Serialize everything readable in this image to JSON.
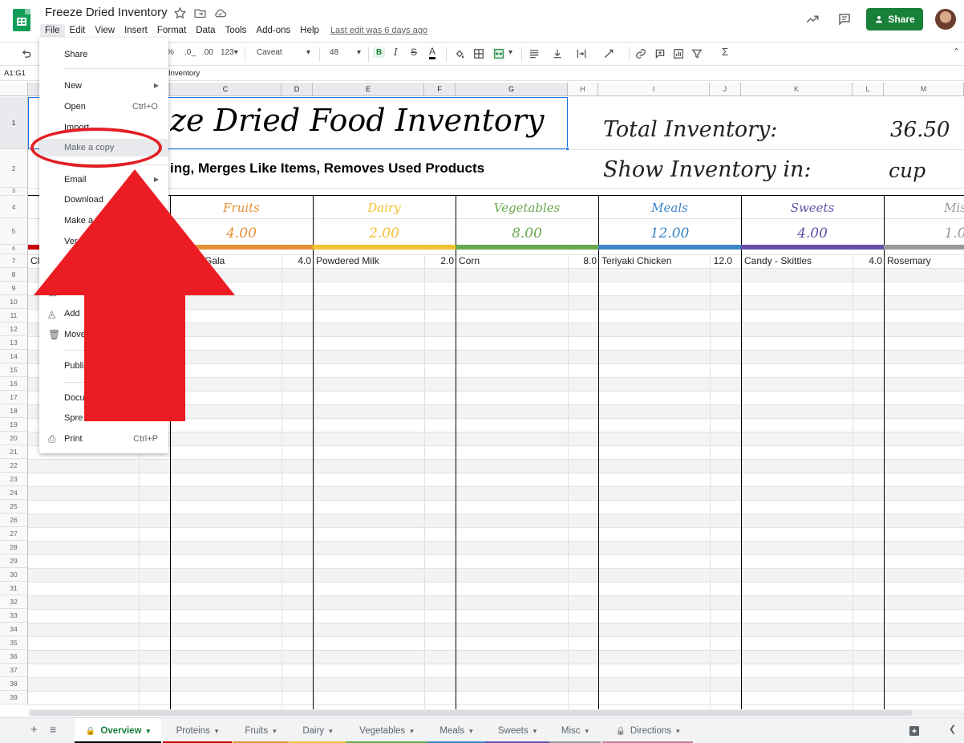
{
  "header": {
    "doc_title": "Freeze Dried Inventory",
    "menus": [
      "File",
      "Edit",
      "View",
      "Insert",
      "Format",
      "Data",
      "Tools",
      "Add-ons",
      "Help"
    ],
    "last_edit": "Last edit was 6 days ago",
    "share_label": "Share",
    "icons": [
      "star-icon",
      "move-folder-icon",
      "cloud-status-icon",
      "activity-trend-icon",
      "comments-icon",
      "share-person-icon",
      "account-avatar"
    ]
  },
  "toolbar": {
    "percent": "%",
    "dec_decrease": ".0_",
    "dec_increase": ".00",
    "format_123": "123",
    "font": "Caveat",
    "font_size": "48",
    "bold": "B"
  },
  "formula_bar": {
    "name_box": "A1:G1",
    "content": "Inventory"
  },
  "columns": [
    "C",
    "D",
    "E",
    "F",
    "G",
    "H",
    "I",
    "J",
    "K",
    "L",
    "M"
  ],
  "rows": [
    "1",
    "2",
    "3",
    "4",
    "5",
    "6",
    "7",
    "8",
    "9",
    "10",
    "11",
    "12",
    "13",
    "14",
    "15",
    "16",
    "17",
    "18",
    "19",
    "20",
    "21",
    "22",
    "23",
    "24",
    "25",
    "26",
    "27",
    "28",
    "29",
    "30",
    "31",
    "32",
    "33",
    "34",
    "35",
    "36",
    "37",
    "38",
    "39"
  ],
  "sheet": {
    "title": "ze Dried Food Inventory",
    "subtitle": "ing, Merges Like Items, Removes Used Products",
    "total_label": "Total Inventory:",
    "total_value": "36.50",
    "show_label": "Show Inventory in:",
    "show_value": "cup",
    "categories": [
      {
        "name": "Fruits",
        "value": "4.00",
        "color": "#e69138"
      },
      {
        "name": "Dairy",
        "value": "2.00",
        "color": "#f1c232"
      },
      {
        "name": "Vegetables",
        "value": "8.00",
        "color": "#6aa84f"
      },
      {
        "name": "Meals",
        "value": "12.00",
        "color": "#3d85c6"
      },
      {
        "name": "Sweets",
        "value": "4.00",
        "color": "#674ea7"
      },
      {
        "name": "Mis",
        "value": "1.0",
        "color": "#999999"
      }
    ],
    "row7": {
      "a": "Cl",
      "fruit": "Gala",
      "fruit_qty": "4.0",
      "dairy": "Powdered Milk",
      "dairy_qty": "2.0",
      "veg": "Corn",
      "veg_qty": "8.0",
      "meal": "Teriyaki Chicken",
      "meal_qty": "12.0",
      "sweet": "Candy - Skittles",
      "sweet_qty": "4.0",
      "misc": "Rosemary"
    }
  },
  "file_menu": {
    "share": "Share",
    "new": "New",
    "open": "Open",
    "open_shortcut": "Ctrl+O",
    "import": "Import",
    "make_copy": "Make a copy",
    "email": "Email",
    "download": "Download",
    "make_available": "Make a",
    "version": "Ver",
    "move": "Mo",
    "add_shortcut": "Add",
    "move_trash": "Move",
    "publish": "Publi",
    "document_details": "Docu",
    "spreadsheet_settings": "Spre",
    "print": "Print",
    "print_shortcut": "Ctrl+P"
  },
  "tabs": [
    {
      "label": "Overview",
      "color": "#000000",
      "active": true
    },
    {
      "label": "Proteins",
      "color": "#cc0000"
    },
    {
      "label": "Fruits",
      "color": "#e69138"
    },
    {
      "label": "Dairy",
      "color": "#f1c232"
    },
    {
      "label": "Vegetables",
      "color": "#6aa84f"
    },
    {
      "label": "Meals",
      "color": "#3d85c6"
    },
    {
      "label": "Sweets",
      "color": "#674ea7"
    },
    {
      "label": "Misc",
      "color": "#999999"
    },
    {
      "label": "Directions",
      "color": "#c27ba0"
    }
  ],
  "annotation": {
    "highlight_color": "#e31e24"
  }
}
